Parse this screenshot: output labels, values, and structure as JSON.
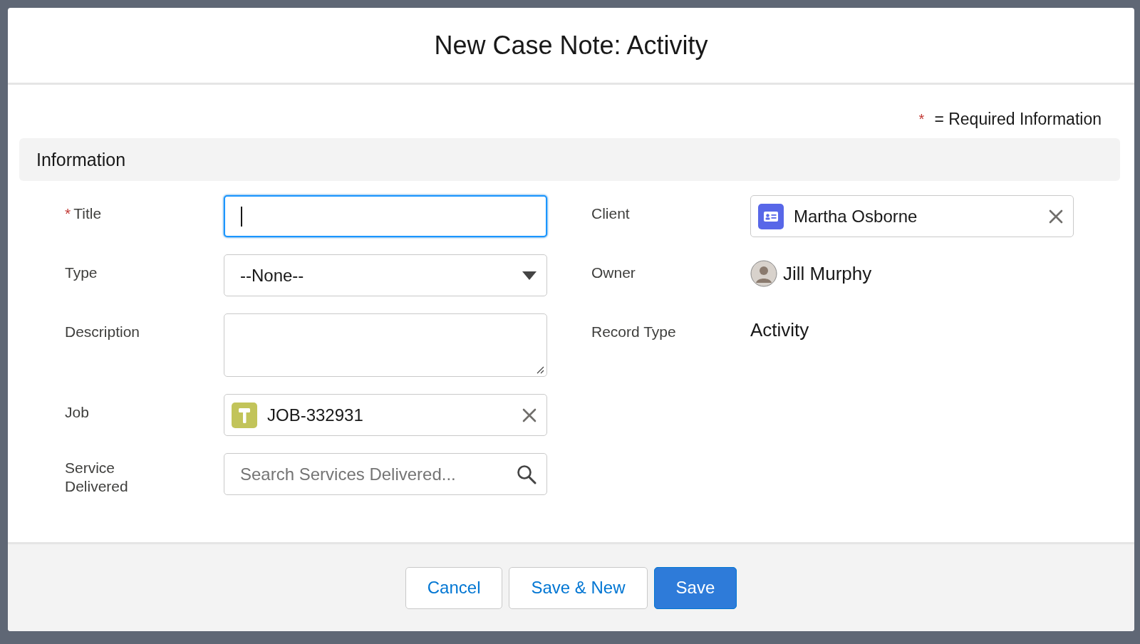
{
  "modal": {
    "title": "New Case Note: Activity"
  },
  "required_note": {
    "marker": "*",
    "text": "= Required Information"
  },
  "section": {
    "title": "Information"
  },
  "left_fields": [
    {
      "kind": "text",
      "label": "Title",
      "required": true,
      "focused": true
    },
    {
      "kind": "select",
      "label": "Type",
      "required": false,
      "focused": false,
      "value": "--None--"
    },
    {
      "kind": "textarea",
      "label": "Description",
      "required": false,
      "focused": false
    },
    {
      "kind": "lookup",
      "label": "Job",
      "required": false,
      "focused": false,
      "value": "JOB-332931"
    },
    {
      "kind": "search",
      "label": "Service Delivered",
      "required": false,
      "focused": false,
      "placeholder": "Search Services Delivered..."
    }
  ],
  "right_fields": [
    {
      "kind": "lookup",
      "label": "Client",
      "value": "Martha Osborne"
    },
    {
      "kind": "user",
      "label": "Owner",
      "value": "Jill Murphy"
    },
    {
      "kind": "text",
      "label": "Record Type",
      "value": "Activity"
    }
  ],
  "buttons": [
    {
      "label": "Cancel",
      "kind": "neutral"
    },
    {
      "label": "Save & New",
      "kind": "neutral"
    },
    {
      "label": "Save",
      "kind": "brand"
    }
  ]
}
